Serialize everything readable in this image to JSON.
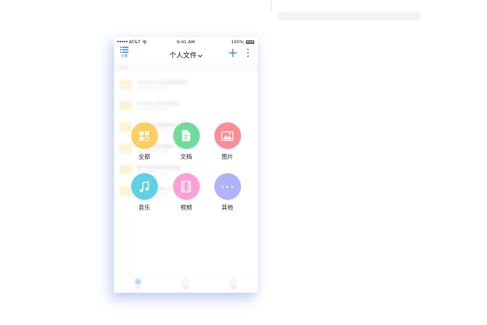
{
  "statusbar": {
    "carrier": "AT&T",
    "time": "9:41 AM",
    "battery": "100%"
  },
  "navbar": {
    "list_label": "分类",
    "title": "个人文件",
    "add_icon": "plus-icon",
    "more_icon": "vertical-dots-icon"
  },
  "section": {
    "label": "文件"
  },
  "files": [
    {
      "name": "2018年公司区域发展规划",
      "meta": "2018-09-01 12:00"
    },
    {
      "name": "2018年工作计划报告",
      "meta": "2018-09-01 12:00"
    },
    {
      "name": "第一季度销售数据分析报告",
      "meta": "2018-09-01 12:00"
    },
    {
      "name": "2018年度总结报告",
      "meta": "2018-09-01 12:00"
    },
    {
      "name": "用户体验调研分析报告",
      "meta": "2018-09-01 12:00"
    },
    {
      "name": "产品需求文档汇总",
      "meta": "2018-09-01 12:00"
    }
  ],
  "categories": [
    {
      "label": "全部",
      "icon": "grid-icon",
      "color": "#fccd62"
    },
    {
      "label": "文档",
      "icon": "document-icon",
      "color": "#6fdc9a"
    },
    {
      "label": "图片",
      "icon": "image-icon",
      "color": "#f98e96"
    },
    {
      "label": "音乐",
      "icon": "music-icon",
      "color": "#5fd1e6"
    },
    {
      "label": "视频",
      "icon": "video-icon",
      "color": "#fb9fd9"
    },
    {
      "label": "其他",
      "icon": "more-icon",
      "color": "#aeb3fb"
    }
  ],
  "tabbar": {
    "tabs": [
      "文件",
      "传输",
      "我的"
    ]
  }
}
